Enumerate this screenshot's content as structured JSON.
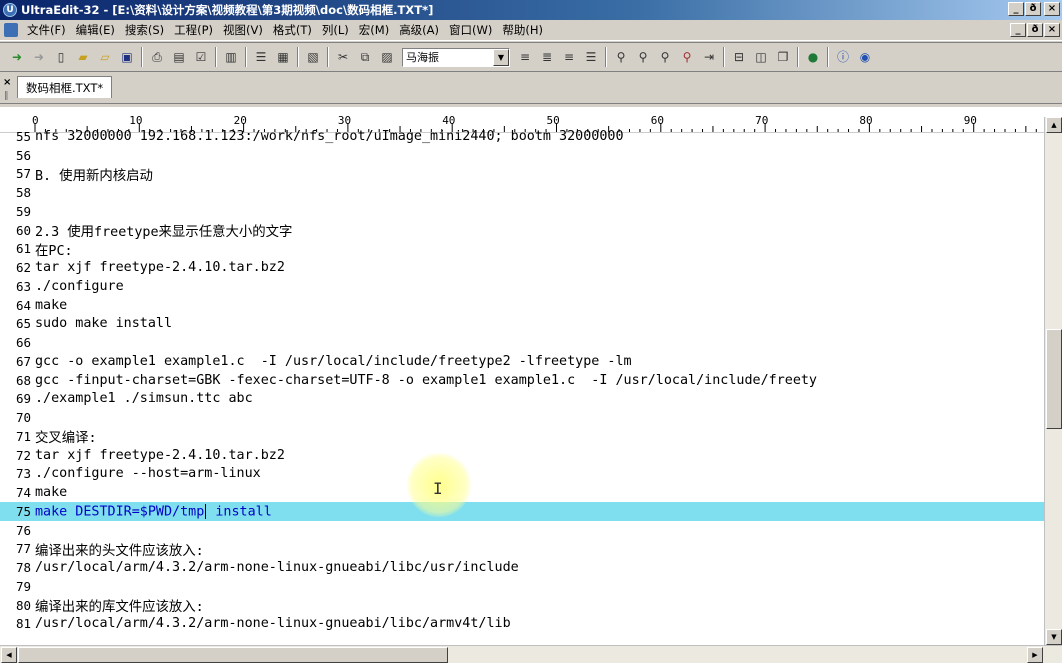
{
  "window": {
    "title": "UltraEdit-32 - [E:\\资料\\设计方案\\视频教程\\第3期视频\\doc\\数码相框.TXT*]",
    "app_icon": "ultraedit-app-icon",
    "controls": [
      "_",
      "ð",
      "×"
    ]
  },
  "menu": {
    "items": [
      "文件(F)",
      "编辑(E)",
      "搜索(S)",
      "工程(P)",
      "视图(V)",
      "格式(T)",
      "列(L)",
      "宏(M)",
      "高级(A)",
      "窗口(W)",
      "帮助(H)"
    ],
    "mdi_controls": [
      "_",
      "ð",
      "×"
    ]
  },
  "toolbar": {
    "font_name": "马海振",
    "icons": [
      "undo-icon",
      "redo-icon",
      "new-file-icon",
      "open-folder-icon",
      "open-icon",
      "save-icon",
      "print-icon",
      "print-preview-icon",
      "spellcheck-icon",
      "properties-icon",
      "word-wrap-icon",
      "hex-icon",
      "clipboard-icon",
      "cut-icon",
      "copy-icon",
      "paste-icon"
    ]
  },
  "tabs": [
    {
      "label": "数码相框.TXT*"
    }
  ],
  "ruler": {
    "labels": [
      "0",
      "10",
      "20",
      "30",
      "40",
      "50",
      "60",
      "70",
      "80",
      "90"
    ]
  },
  "editor": {
    "active_line": 75,
    "lines": [
      {
        "n": "55",
        "text": "nfs 32000000 192.168.1.123:/work/nfs_root/uImage_mini2440; bootm 32000000"
      },
      {
        "n": "56",
        "text": ""
      },
      {
        "n": "57",
        "text": "B. 使用新内核启动"
      },
      {
        "n": "58",
        "text": ""
      },
      {
        "n": "59",
        "text": ""
      },
      {
        "n": "60",
        "text": "2.3 使用freetype来显示任意大小的文字"
      },
      {
        "n": "61",
        "text": "在PC:"
      },
      {
        "n": "62",
        "text": "tar xjf freetype-2.4.10.tar.bz2"
      },
      {
        "n": "63",
        "text": "./configure"
      },
      {
        "n": "64",
        "text": "make"
      },
      {
        "n": "65",
        "text": "sudo make install"
      },
      {
        "n": "66",
        "text": ""
      },
      {
        "n": "67",
        "text": "gcc -o example1 example1.c  -I /usr/local/include/freetype2 -lfreetype -lm"
      },
      {
        "n": "68",
        "text": "gcc -finput-charset=GBK -fexec-charset=UTF-8 -o example1 example1.c  -I /usr/local/include/freety"
      },
      {
        "n": "69",
        "text": "./example1 ./simsun.ttc abc"
      },
      {
        "n": "70",
        "text": ""
      },
      {
        "n": "71",
        "text": "交叉编译:"
      },
      {
        "n": "72",
        "text": "tar xjf freetype-2.4.10.tar.bz2"
      },
      {
        "n": "73",
        "text": "./configure --host=arm-linux"
      },
      {
        "n": "74",
        "text": "make"
      },
      {
        "n": "75",
        "text_before": "make DESTDIR=$PWD/tmp",
        "text_after": " install"
      },
      {
        "n": "76",
        "text": ""
      },
      {
        "n": "77",
        "text": "编译出来的头文件应该放入:"
      },
      {
        "n": "78",
        "text": "/usr/local/arm/4.3.2/arm-none-linux-gnueabi/libc/usr/include"
      },
      {
        "n": "79",
        "text": ""
      },
      {
        "n": "80",
        "text": "编译出来的库文件应该放入:"
      },
      {
        "n": "81",
        "text": "/usr/local/arm/4.3.2/arm-none-linux-gnueabi/libc/armv4t/lib"
      }
    ]
  },
  "colors": {
    "active_line_bg": "#7fdfef",
    "active_line_text": "#0000c8",
    "titlebar_start": "#0a246a",
    "titlebar_end": "#a6caf0"
  }
}
